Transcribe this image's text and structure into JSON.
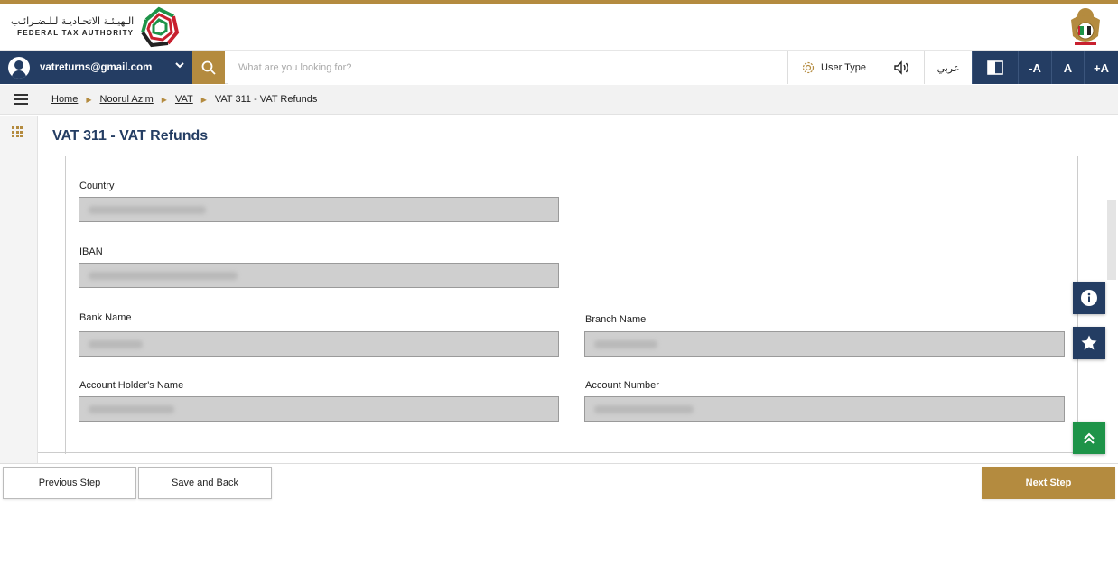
{
  "header": {
    "logo_ar": "الـهيـئـة الاتحـاديـة لـلـضـرائـب",
    "logo_en": "FEDERAL TAX AUTHORITY"
  },
  "topbar": {
    "user_email": "vatreturns@gmail.com",
    "search_placeholder": "What are you looking for?",
    "user_type_label": "User Type",
    "arabic_label": "عربي",
    "font_decrease": "-A",
    "font_normal": "A",
    "font_increase": "+A"
  },
  "breadcrumb": {
    "items": [
      "Home",
      "Noorul Azim",
      "VAT"
    ],
    "current": "VAT 311 - VAT Refunds"
  },
  "page": {
    "title": "VAT 311 - VAT Refunds"
  },
  "form": {
    "country_label": "Country",
    "iban_label": "IBAN",
    "bank_name_label": "Bank Name",
    "branch_name_label": "Branch Name",
    "account_holder_label": "Account Holder's Name",
    "account_number_label": "Account Number"
  },
  "footer": {
    "previous_label": "Previous Step",
    "save_back_label": "Save and Back",
    "next_label": "Next Step"
  },
  "colors": {
    "navy": "#243d63",
    "gold": "#b48b3f",
    "green": "#1d9348"
  },
  "icons": [
    "user-icon",
    "chevron-down-icon",
    "search-icon",
    "gear-icon",
    "speaker-icon",
    "contrast-icon",
    "hamburger-icon",
    "apps-grid-icon",
    "info-icon",
    "star-icon",
    "chevrons-up-icon"
  ]
}
